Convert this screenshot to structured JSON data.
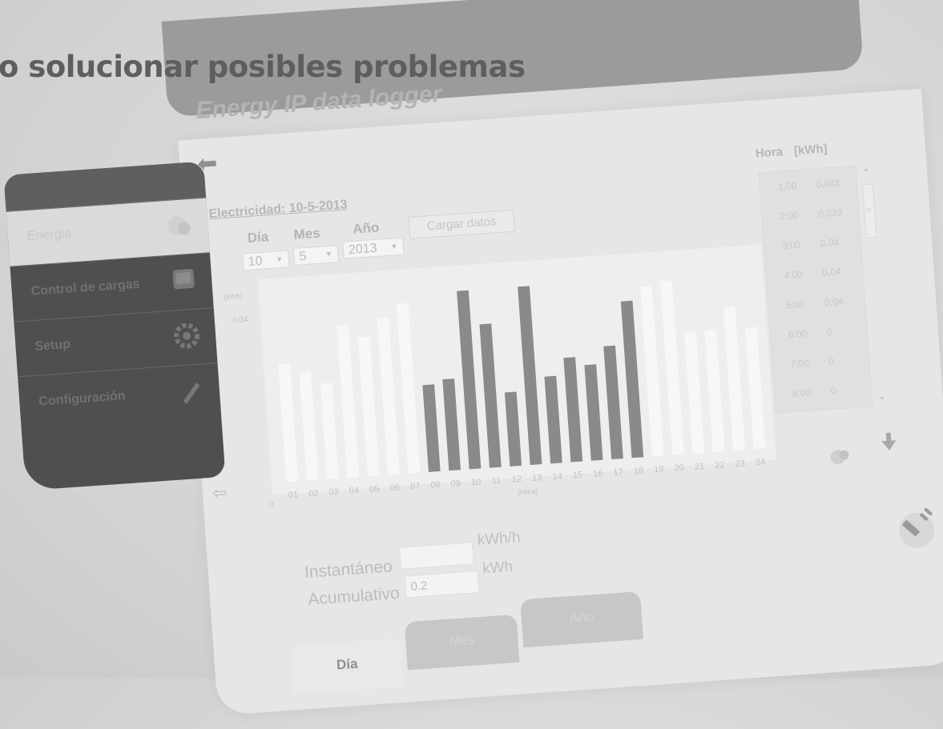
{
  "heading": "o solucionar posibles problemas",
  "app_title": "Energy IP data logger",
  "sidebar": {
    "items": [
      {
        "label": "Energia",
        "icon": "energy-meter-icon",
        "active": true
      },
      {
        "label": "Control de cargas",
        "icon": "loads-control-icon",
        "active": false
      },
      {
        "label": "Setup",
        "icon": "gear-icon",
        "active": false
      },
      {
        "label": "Configuración",
        "icon": "pencil-icon",
        "active": false
      }
    ]
  },
  "main": {
    "title": "Electricidad: 10-5-2013",
    "selectors": {
      "day_label": "Día",
      "month_label": "Mes",
      "year_label": "Año",
      "day_value": "10",
      "month_value": "5",
      "year_value": "2013",
      "load_button": "Cargar datos"
    }
  },
  "chart_data": {
    "type": "bar",
    "ylabel": "[kWh]",
    "xlabel": "[Hora]",
    "ytick_top": "0,04",
    "ytick_zero": "0",
    "categories": [
      "01",
      "02",
      "03",
      "04",
      "05",
      "06",
      "07",
      "08",
      "09",
      "10",
      "11",
      "12",
      "13",
      "14",
      "15",
      "16",
      "17",
      "18",
      "19",
      "20",
      "21",
      "22",
      "23",
      "24"
    ],
    "values": [
      0.027,
      0.025,
      0.022,
      0.035,
      0.032,
      0.036,
      0.039,
      0.02,
      0.021,
      0.041,
      0.033,
      0.017,
      0.041,
      0.02,
      0.024,
      0.022,
      0.026,
      0.036,
      0.039,
      0.04,
      0.028,
      0.028,
      0.033,
      0.028
    ],
    "highlighted": [
      false,
      false,
      false,
      false,
      false,
      false,
      false,
      true,
      true,
      true,
      true,
      true,
      true,
      true,
      true,
      true,
      true,
      true,
      false,
      false,
      false,
      false,
      false,
      false
    ],
    "ylim": [
      0,
      0.045
    ],
    "colors": {
      "highlight": "#8a8a8a",
      "normal": "#f7f7f7",
      "label": "#c2c2c2"
    }
  },
  "table": {
    "head_hour": "Hora",
    "head_kwh": "[kWh]",
    "rows": [
      {
        "hour": "1:00",
        "value": "0,041"
      },
      {
        "hour": "2:00",
        "value": "0,039"
      },
      {
        "hour": "3:00",
        "value": "0,04"
      },
      {
        "hour": "4:00",
        "value": "0,04"
      },
      {
        "hour": "5:00",
        "value": "0,04"
      },
      {
        "hour": "6:00",
        "value": "0"
      },
      {
        "hour": "7:00",
        "value": "0"
      },
      {
        "hour": "8:00",
        "value": "0"
      }
    ]
  },
  "measures": {
    "instant_label": "Instantáneo",
    "instant_value": "",
    "instant_unit": "kWh/h",
    "cumulative_label": "Acumulativo",
    "cumulative_value": "0.2",
    "cumulative_unit": "kWh"
  },
  "tabs": [
    {
      "label": "Día",
      "active": true
    },
    {
      "label": "Mes",
      "active": false
    },
    {
      "label": "Año",
      "active": false
    }
  ]
}
